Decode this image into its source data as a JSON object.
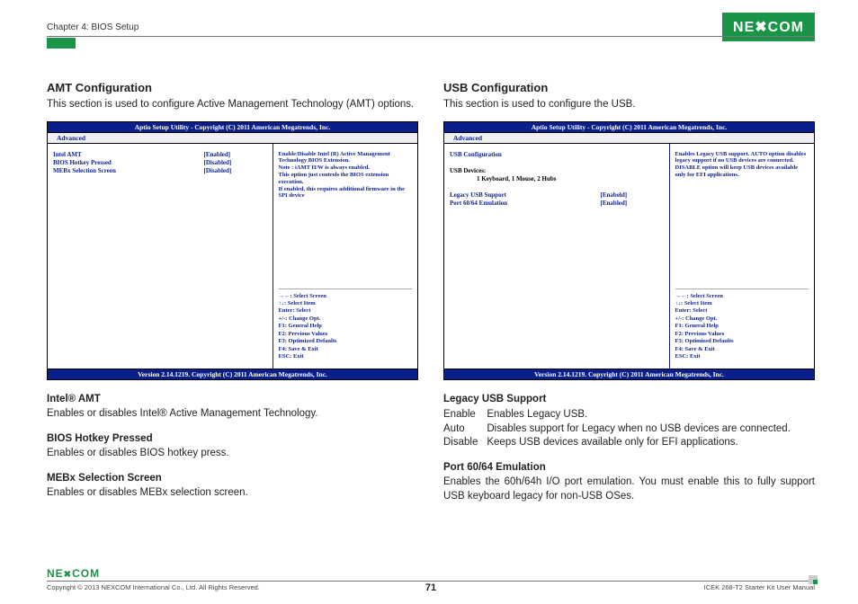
{
  "header": {
    "chapter": "Chapter 4: BIOS Setup",
    "logo_text": "NE COM",
    "logo_x": "X"
  },
  "left": {
    "title": "AMT Configuration",
    "intro": "This section is used to configure Active Management Technology (AMT) options.",
    "bios": {
      "topbar": "Aptio Setup Utility - Copyright (C) 2011 American Megatrends, Inc.",
      "tab": "Advanced",
      "rows": [
        {
          "k": "Intel AMT",
          "v": "[Enabled]",
          "style": "blue"
        },
        {
          "k": "BIOS Hotkey Pressed",
          "v": "[Disabled]",
          "style": "blue"
        },
        {
          "k": "MEBx Selection Screen",
          "v": "[Disabled]",
          "style": "blue"
        }
      ],
      "help": "Enable/Disable Intel (R) Active Management Technology BIOS Extension.\nNote : iAMT H/W is always enabled.\nThis option just controls the BIOS extension execution.\nIf enabled, this requires additional firmware in the SPI device",
      "keyhelp": "→←: Select Screen\n↑↓: Select Item\nEnter: Select\n+/-: Change Opt.\nF1: General Help\nF2: Previous Values\nF3: Optimized Defaults\nF4: Save & Exit\nESC: Exit",
      "bottombar": "Version 2.14.1219. Copyright (C) 2011 American Megatrends, Inc."
    },
    "defs": [
      {
        "h": "Intel® AMT",
        "p": "Enables or disables Intel® Active Management Technology."
      },
      {
        "h": "BIOS Hotkey Pressed",
        "p": "Enables or disables BIOS hotkey press."
      },
      {
        "h": "MEBx Selection Screen",
        "p": "Enables or disables MEBx selection screen."
      }
    ]
  },
  "right": {
    "title": "USB Configuration",
    "intro": "This section is used to configure the USB.",
    "bios": {
      "topbar": "Aptio Setup Utility - Copyright (C) 2011 American Megatrends, Inc.",
      "tab": "Advanced",
      "rows": [
        {
          "k": "USB Configuration",
          "v": "",
          "style": "blue"
        },
        {
          "k": "",
          "v": "",
          "style": "blank"
        },
        {
          "k": "USB Devices:",
          "v": "",
          "style": "black"
        },
        {
          "k": "        1 Keyboard, 1 Mouse, 2 Hubs",
          "v": "",
          "style": "black",
          "sub": true
        },
        {
          "k": "",
          "v": "",
          "style": "blank"
        },
        {
          "k": "Legacy USB Support",
          "v": "[Enabeld]",
          "style": "blue"
        },
        {
          "k": "Port 60/64 Emulation",
          "v": "[Enabled]",
          "style": "blue"
        }
      ],
      "help": "Enables Legacy USB support. AUTO option disables legacy support if no USB devices are connected. DISABLE option will keep USB devices available only for EFI applications.",
      "keyhelp": "→←: Select Screen\n↑↓: Select Item\nEnter: Select\n+/-: Change Opt.\nF1: General Help\nF2: Previous Values\nF3: Optimized Defaults\nF4: Save & Exit\nESC: Exit",
      "bottombar": "Version 2.14.1219. Copyright (C) 2011 American Megatrends, Inc."
    },
    "defs_legacy": {
      "h": "Legacy USB Support",
      "rows": [
        {
          "k": "Enable",
          "v": "Enables Legacy USB."
        },
        {
          "k": "Auto",
          "v": "Disables support for Legacy when no USB devices are connected."
        },
        {
          "k": "Disable",
          "v": "Keeps USB devices available only for EFI applications."
        }
      ]
    },
    "defs_port": {
      "h": "Port 60/64 Emulation",
      "p": "Enables the 60h/64h I/O port emulation. You must enable this to fully support USB keyboard legacy for non-USB OSes."
    }
  },
  "footer": {
    "logo": "NEXCOM",
    "copyright": "Copyright © 2013 NEXCOM International Co., Ltd. All Rights Reserved.",
    "page": "71",
    "doc": "ICEK 268-T2 Starter Kit User Manual"
  }
}
